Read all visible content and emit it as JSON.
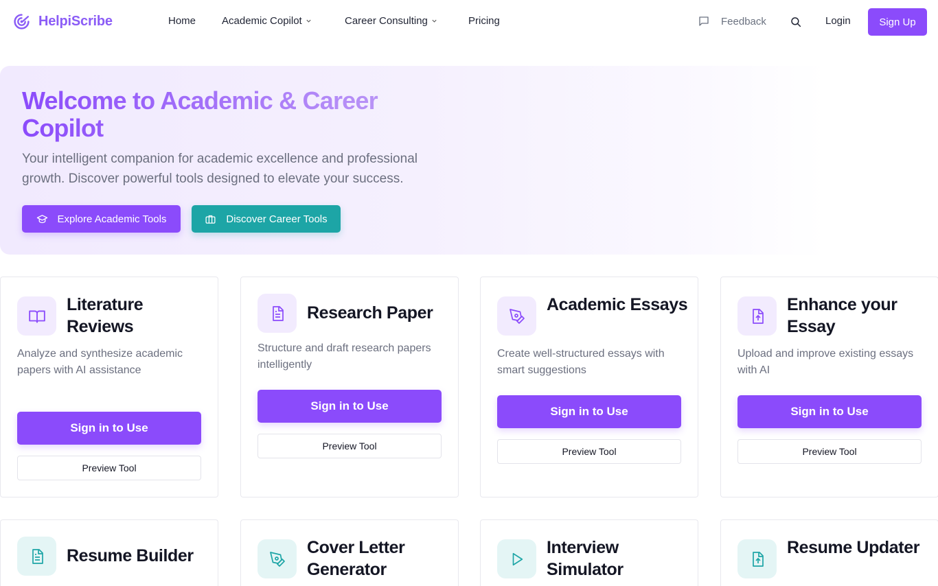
{
  "brand": {
    "name": "HelpiScribe",
    "color": "#8b5cf6"
  },
  "nav": {
    "home": "Home",
    "academic_copilot": "Academic Copilot",
    "career_consulting": "Career Consulting",
    "pricing": "Pricing",
    "feedback": "Feedback",
    "login": "Login",
    "signup": "Sign Up"
  },
  "hero": {
    "title": "Welcome to Academic & Career Copilot",
    "subtitle": "Your intelligent companion for academic excellence and professional growth. Discover powerful tools designed to elevate your success.",
    "btn_academic": "Explore Academic Tools",
    "btn_career": "Discover Career Tools"
  },
  "cards": [
    {
      "title": "Literature Reviews",
      "desc": "Analyze and synthesize academic papers with AI assistance",
      "sign": "Sign in to Use",
      "preview": "Preview Tool",
      "icon": "book-open-icon"
    },
    {
      "title": "Research Paper",
      "desc": "Structure and draft research papers intelligently",
      "sign": "Sign in to Use",
      "preview": "Preview Tool",
      "icon": "document-icon"
    },
    {
      "title": "Academic Essays",
      "desc": "Create well-structured essays with smart suggestions",
      "sign": "Sign in to Use",
      "preview": "Preview Tool",
      "icon": "pen-tool-icon"
    },
    {
      "title": "Enhance your Essay",
      "desc": "Upload and improve existing essays with AI",
      "sign": "Sign in to Use",
      "preview": "Preview Tool",
      "icon": "file-upload-icon"
    },
    {
      "title": "Resume Builder",
      "icon": "document-icon"
    },
    {
      "title": "Cover Letter Generator",
      "icon": "pen-tool-icon"
    },
    {
      "title": "Interview Simulator",
      "icon": "play-icon"
    },
    {
      "title": "Resume Updater",
      "icon": "file-upload-icon"
    }
  ],
  "colors": {
    "primary": "#8b4bfb",
    "teal": "#1da5a6"
  }
}
